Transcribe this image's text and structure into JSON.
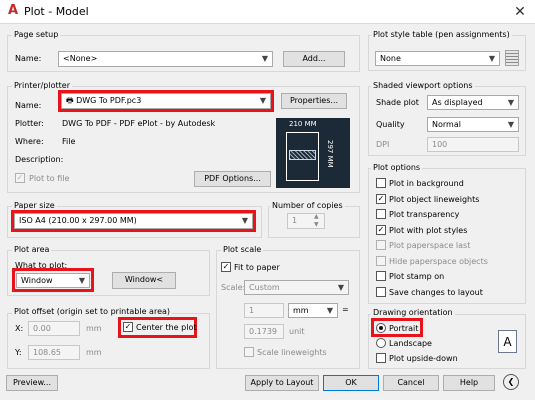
{
  "window": {
    "title": "Plot - Model",
    "close": "✕"
  },
  "page_setup": {
    "group": "Page setup",
    "name_label": "Name:",
    "name_value": "<None>",
    "add_button": "Add..."
  },
  "printer": {
    "group": "Printer/plotter",
    "name_label": "Name:",
    "name_value": "DWG To PDF.pc3",
    "properties_button": "Properties...",
    "plotter_label": "Plotter:",
    "plotter_value": "DWG To PDF - PDF ePlot - by Autodesk",
    "where_label": "Where:",
    "where_value": "File",
    "description_label": "Description:",
    "plot_to_file": "Plot to file",
    "pdf_options_button": "PDF Options...",
    "preview_width": "210 MM",
    "preview_height": "297 MM"
  },
  "paper_size": {
    "group": "Paper size",
    "value": "ISO A4 (210.00 x 297.00 MM)"
  },
  "copies": {
    "group": "Number of copies",
    "value": "1"
  },
  "plot_area": {
    "group": "Plot area",
    "what_label": "What to plot:",
    "what_value": "Window",
    "window_button": "Window<"
  },
  "plot_scale": {
    "group": "Plot scale",
    "fit_to_paper": "Fit to paper",
    "scale_label": "Scale:",
    "scale_value": "Custom",
    "value1": "1",
    "unit1": "mm",
    "equals": "=",
    "value2": "0.1739",
    "unit2": "unit",
    "scale_lineweights": "Scale lineweights"
  },
  "plot_offset": {
    "group": "Plot offset (origin set to printable area)",
    "x_label": "X:",
    "x_value": "0.00",
    "x_unit": "mm",
    "y_label": "Y:",
    "y_value": "108.65",
    "y_unit": "mm",
    "center": "Center the plot"
  },
  "style_table": {
    "group": "Plot style table (pen assignments)",
    "value": "None"
  },
  "shaded": {
    "group": "Shaded viewport options",
    "shade_label": "Shade plot",
    "shade_value": "As displayed",
    "quality_label": "Quality",
    "quality_value": "Normal",
    "dpi_label": "DPI",
    "dpi_value": "100"
  },
  "plot_options": {
    "group": "Plot options",
    "items": [
      {
        "label": "Plot in background",
        "checked": false,
        "disabled": false
      },
      {
        "label": "Plot object lineweights",
        "checked": true,
        "disabled": false
      },
      {
        "label": "Plot transparency",
        "checked": false,
        "disabled": false
      },
      {
        "label": "Plot with plot styles",
        "checked": true,
        "disabled": false
      },
      {
        "label": "Plot paperspace last",
        "checked": false,
        "disabled": true
      },
      {
        "label": "Hide paperspace objects",
        "checked": false,
        "disabled": true
      },
      {
        "label": "Plot stamp on",
        "checked": false,
        "disabled": false
      },
      {
        "label": "Save changes to layout",
        "checked": false,
        "disabled": false
      }
    ]
  },
  "orientation": {
    "group": "Drawing orientation",
    "portrait": "Portrait",
    "landscape": "Landscape",
    "upside_down": "Plot upside-down",
    "icon_letter": "A"
  },
  "footer": {
    "preview": "Preview...",
    "apply": "Apply to Layout",
    "ok": "OK",
    "cancel": "Cancel",
    "help": "Help",
    "collapse": "❮"
  },
  "colors": {
    "highlight": "#e8141c",
    "preview_bg": "#1b2a36"
  }
}
